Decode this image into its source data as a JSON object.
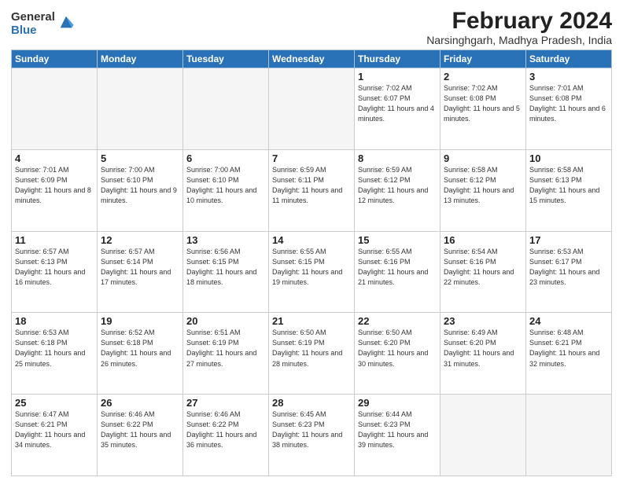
{
  "header": {
    "logo_general": "General",
    "logo_blue": "Blue",
    "month_year": "February 2024",
    "location": "Narsinghgarh, Madhya Pradesh, India"
  },
  "days_of_week": [
    "Sunday",
    "Monday",
    "Tuesday",
    "Wednesday",
    "Thursday",
    "Friday",
    "Saturday"
  ],
  "weeks": [
    [
      {
        "day": "",
        "sun": "",
        "set": "",
        "day_len": ""
      },
      {
        "day": "",
        "sun": "",
        "set": "",
        "day_len": ""
      },
      {
        "day": "",
        "sun": "",
        "set": "",
        "day_len": ""
      },
      {
        "day": "",
        "sun": "",
        "set": "",
        "day_len": ""
      },
      {
        "day": "1",
        "sun": "7:02 AM",
        "set": "6:07 PM",
        "day_len": "11 hours and 4 minutes."
      },
      {
        "day": "2",
        "sun": "7:02 AM",
        "set": "6:08 PM",
        "day_len": "11 hours and 5 minutes."
      },
      {
        "day": "3",
        "sun": "7:01 AM",
        "set": "6:08 PM",
        "day_len": "11 hours and 6 minutes."
      }
    ],
    [
      {
        "day": "4",
        "sun": "7:01 AM",
        "set": "6:09 PM",
        "day_len": "11 hours and 8 minutes."
      },
      {
        "day": "5",
        "sun": "7:00 AM",
        "set": "6:10 PM",
        "day_len": "11 hours and 9 minutes."
      },
      {
        "day": "6",
        "sun": "7:00 AM",
        "set": "6:10 PM",
        "day_len": "11 hours and 10 minutes."
      },
      {
        "day": "7",
        "sun": "6:59 AM",
        "set": "6:11 PM",
        "day_len": "11 hours and 11 minutes."
      },
      {
        "day": "8",
        "sun": "6:59 AM",
        "set": "6:12 PM",
        "day_len": "11 hours and 12 minutes."
      },
      {
        "day": "9",
        "sun": "6:58 AM",
        "set": "6:12 PM",
        "day_len": "11 hours and 13 minutes."
      },
      {
        "day": "10",
        "sun": "6:58 AM",
        "set": "6:13 PM",
        "day_len": "11 hours and 15 minutes."
      }
    ],
    [
      {
        "day": "11",
        "sun": "6:57 AM",
        "set": "6:13 PM",
        "day_len": "11 hours and 16 minutes."
      },
      {
        "day": "12",
        "sun": "6:57 AM",
        "set": "6:14 PM",
        "day_len": "11 hours and 17 minutes."
      },
      {
        "day": "13",
        "sun": "6:56 AM",
        "set": "6:15 PM",
        "day_len": "11 hours and 18 minutes."
      },
      {
        "day": "14",
        "sun": "6:55 AM",
        "set": "6:15 PM",
        "day_len": "11 hours and 19 minutes."
      },
      {
        "day": "15",
        "sun": "6:55 AM",
        "set": "6:16 PM",
        "day_len": "11 hours and 21 minutes."
      },
      {
        "day": "16",
        "sun": "6:54 AM",
        "set": "6:16 PM",
        "day_len": "11 hours and 22 minutes."
      },
      {
        "day": "17",
        "sun": "6:53 AM",
        "set": "6:17 PM",
        "day_len": "11 hours and 23 minutes."
      }
    ],
    [
      {
        "day": "18",
        "sun": "6:53 AM",
        "set": "6:18 PM",
        "day_len": "11 hours and 25 minutes."
      },
      {
        "day": "19",
        "sun": "6:52 AM",
        "set": "6:18 PM",
        "day_len": "11 hours and 26 minutes."
      },
      {
        "day": "20",
        "sun": "6:51 AM",
        "set": "6:19 PM",
        "day_len": "11 hours and 27 minutes."
      },
      {
        "day": "21",
        "sun": "6:50 AM",
        "set": "6:19 PM",
        "day_len": "11 hours and 28 minutes."
      },
      {
        "day": "22",
        "sun": "6:50 AM",
        "set": "6:20 PM",
        "day_len": "11 hours and 30 minutes."
      },
      {
        "day": "23",
        "sun": "6:49 AM",
        "set": "6:20 PM",
        "day_len": "11 hours and 31 minutes."
      },
      {
        "day": "24",
        "sun": "6:48 AM",
        "set": "6:21 PM",
        "day_len": "11 hours and 32 minutes."
      }
    ],
    [
      {
        "day": "25",
        "sun": "6:47 AM",
        "set": "6:21 PM",
        "day_len": "11 hours and 34 minutes."
      },
      {
        "day": "26",
        "sun": "6:46 AM",
        "set": "6:22 PM",
        "day_len": "11 hours and 35 minutes."
      },
      {
        "day": "27",
        "sun": "6:46 AM",
        "set": "6:22 PM",
        "day_len": "11 hours and 36 minutes."
      },
      {
        "day": "28",
        "sun": "6:45 AM",
        "set": "6:23 PM",
        "day_len": "11 hours and 38 minutes."
      },
      {
        "day": "29",
        "sun": "6:44 AM",
        "set": "6:23 PM",
        "day_len": "11 hours and 39 minutes."
      },
      {
        "day": "",
        "sun": "",
        "set": "",
        "day_len": ""
      },
      {
        "day": "",
        "sun": "",
        "set": "",
        "day_len": ""
      }
    ]
  ]
}
